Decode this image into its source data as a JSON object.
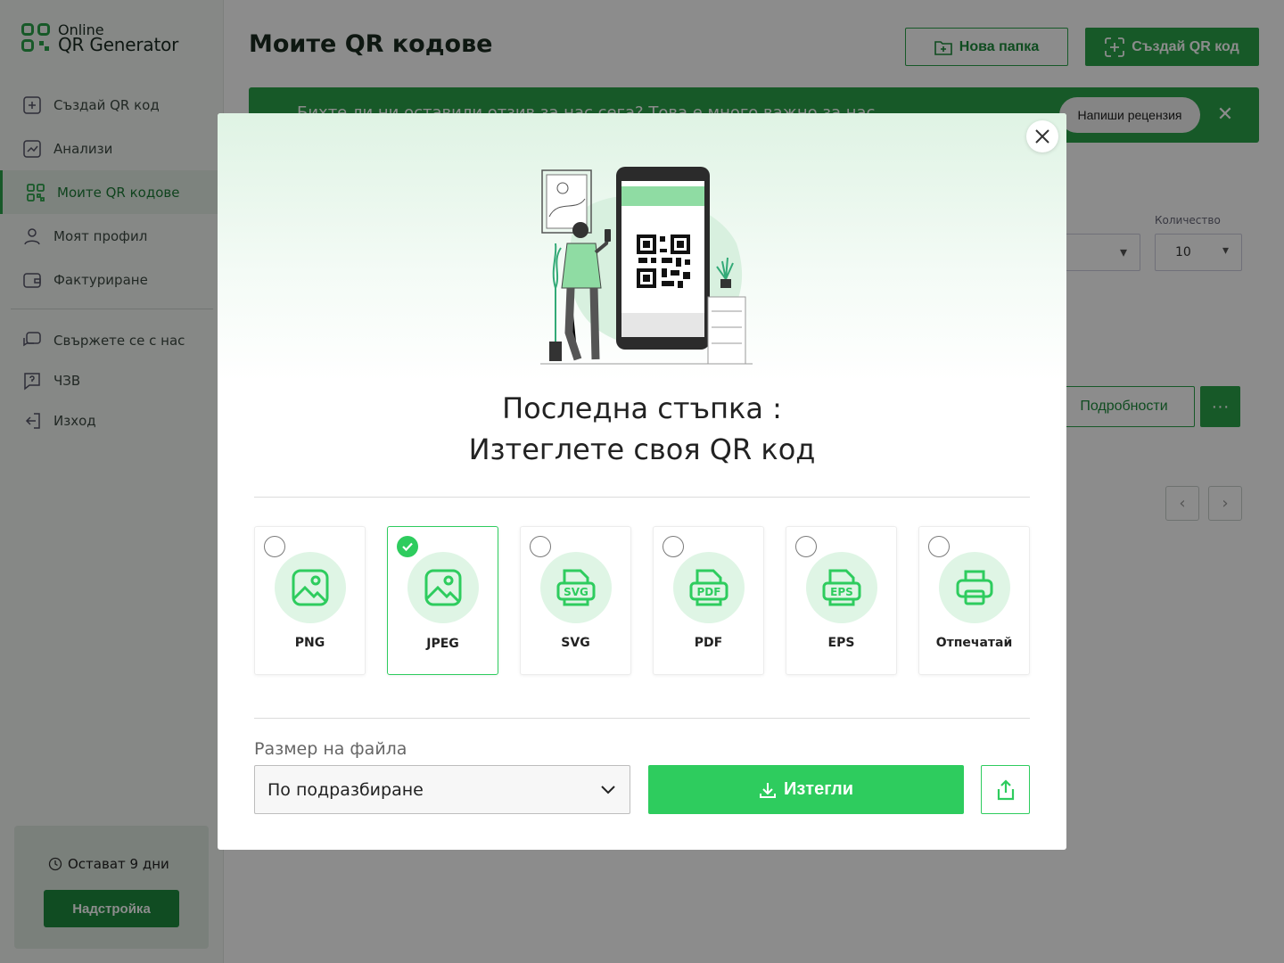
{
  "logo": {
    "line1": "Online",
    "line2": "QR Generator"
  },
  "sidebar": {
    "items": [
      {
        "label": "Създай QR код",
        "icon": "plus-square-icon"
      },
      {
        "label": "Анализи",
        "icon": "chart-icon"
      },
      {
        "label": "Моите QR кодове",
        "icon": "qr-icon",
        "active": true
      },
      {
        "label": "Моят профил",
        "icon": "user-icon"
      },
      {
        "label": "Фактуриране",
        "icon": "wallet-icon"
      }
    ],
    "secondary": [
      {
        "label": "Свържете се с нас",
        "icon": "chat-icon"
      },
      {
        "label": "ЧЗВ",
        "icon": "question-icon"
      },
      {
        "label": "Изход",
        "icon": "logout-icon"
      }
    ],
    "trial_text": "Остават 9 дни",
    "upgrade_label": "Надстройка"
  },
  "main": {
    "title": "Моите QR кодове",
    "new_folder_label": "Нова папка",
    "create_label": "Създай QR код",
    "banner_text": "Бихте ли ни оставили отзив за нас сега? Това е много важно за нас",
    "banner_review_label": "Напиши рецензия",
    "qty_label": "Количество",
    "qty_value": "10",
    "details_label": "Подробности",
    "more_label": "···"
  },
  "modal": {
    "title_line1": "Последна стъпка :",
    "title_line2": "Изтеглете своя QR код",
    "formats": [
      {
        "label": "PNG",
        "icon": "image-icon",
        "selected": false
      },
      {
        "label": "JPEG",
        "icon": "image-icon",
        "selected": true
      },
      {
        "label": "SVG",
        "icon": "svg-file-icon",
        "selected": false
      },
      {
        "label": "PDF",
        "icon": "pdf-file-icon",
        "selected": false
      },
      {
        "label": "EPS",
        "icon": "eps-file-icon",
        "selected": false
      },
      {
        "label": "Отпечатай",
        "icon": "printer-icon",
        "selected": false
      }
    ],
    "size_label": "Размер на файла",
    "size_value": "По подразбиране",
    "download_label": "Изтегли",
    "colors": {
      "accent": "#2ecc5e",
      "accent_light": "#dff5e5",
      "dark_green": "#2aa34a"
    }
  }
}
